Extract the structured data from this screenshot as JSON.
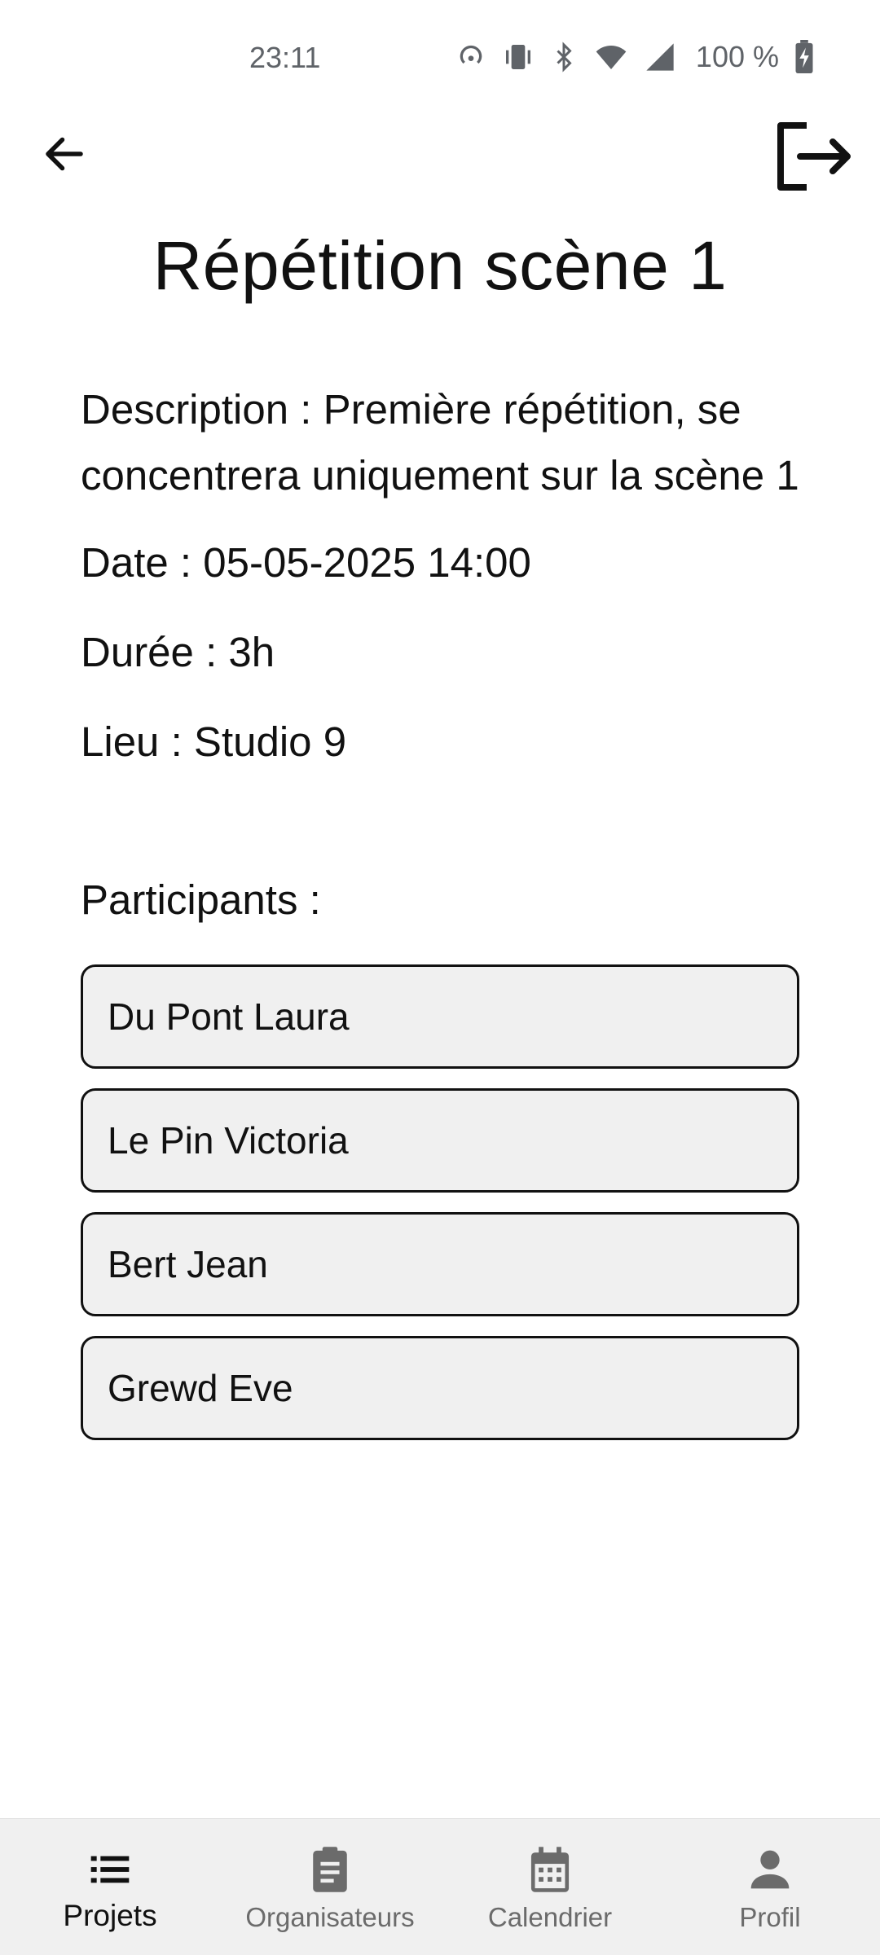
{
  "status_bar": {
    "time": "23:11",
    "battery": "100 %",
    "icons": [
      "hotspot-icon",
      "vibrate-icon",
      "bluetooth-icon",
      "wifi-icon",
      "signal-icon",
      "battery-charging-icon"
    ]
  },
  "header": {
    "back_icon": "arrow-left-icon",
    "logout_icon": "logout-icon"
  },
  "event": {
    "title": "Répétition scène 1",
    "description": "Description : Première répétition, se concentrera uniquement sur la scène 1",
    "date": "Date : 05-05-2025 14:00",
    "duration": "Durée : 3h",
    "location": "Lieu : Studio 9",
    "participants_label": "Participants :",
    "participants": [
      "Du Pont Laura",
      "Le Pin Victoria",
      "Bert Jean",
      "Grewd Eve"
    ]
  },
  "bottom_nav": {
    "items": [
      {
        "label": "Projets",
        "icon": "list-icon",
        "active": true
      },
      {
        "label": "Organisateurs",
        "icon": "clipboard-icon",
        "active": false
      },
      {
        "label": "Calendrier",
        "icon": "calendar-icon",
        "active": false
      },
      {
        "label": "Profil",
        "icon": "person-icon",
        "active": false
      }
    ]
  },
  "colors": {
    "text": "#111111",
    "muted": "#6b6b6b",
    "card_bg": "#f0f0f0",
    "nav_bg": "#f0f0f0"
  }
}
